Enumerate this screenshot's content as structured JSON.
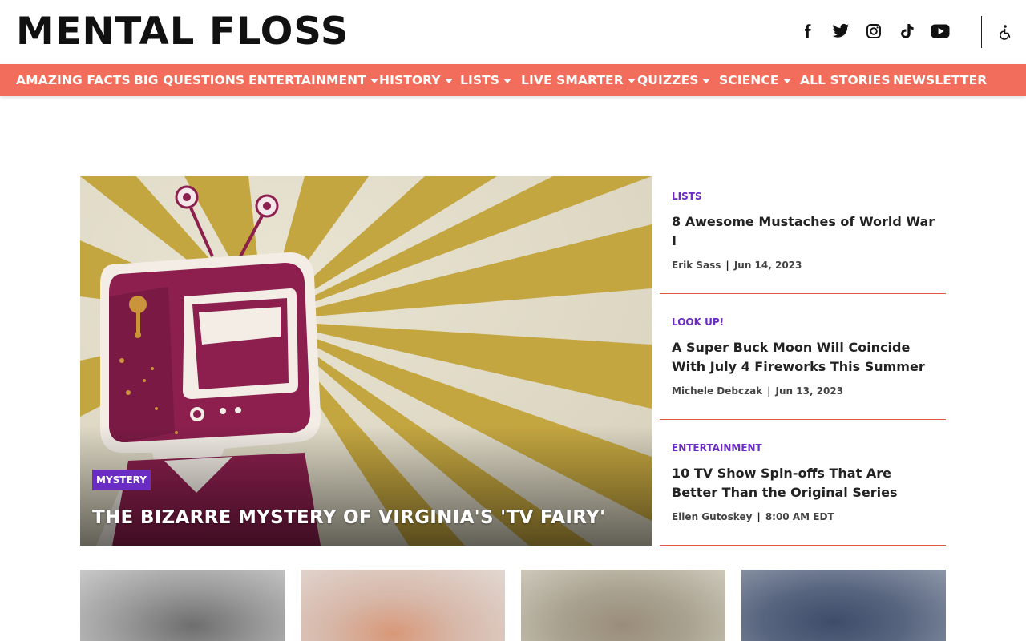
{
  "header": {
    "logo": "MENTAL FLOSS",
    "social": [
      {
        "icon": "facebook-icon"
      },
      {
        "icon": "twitter-icon"
      },
      {
        "icon": "instagram-icon"
      },
      {
        "icon": "tiktok-icon"
      },
      {
        "icon": "youtube-icon"
      }
    ],
    "accessibility_icon": "accessibility-icon"
  },
  "nav": {
    "items": [
      {
        "label": "AMAZING FACTS",
        "dropdown": false
      },
      {
        "label": "BIG QUESTIONS",
        "dropdown": false
      },
      {
        "label": "ENTERTAINMENT",
        "dropdown": true
      },
      {
        "label": "HISTORY",
        "dropdown": true
      },
      {
        "label": "LISTS",
        "dropdown": true
      },
      {
        "label": "LIVE SMARTER",
        "dropdown": true
      },
      {
        "label": "QUIZZES",
        "dropdown": true
      },
      {
        "label": "SCIENCE",
        "dropdown": true
      },
      {
        "label": "ALL STORIES",
        "dropdown": false
      },
      {
        "label": "NEWSLETTER",
        "dropdown": false
      }
    ]
  },
  "hero": {
    "category": "MYSTERY",
    "title": "THE BIZARRE MYSTERY OF VIRGINIA'S 'TV FAIRY'"
  },
  "stories": [
    {
      "category": "LISTS",
      "title": "8 Awesome Mustaches of World War I",
      "author": "Erik Sass",
      "date": "Jun 14, 2023"
    },
    {
      "category": "LOOK UP!",
      "title": "A Super Buck Moon Will Coincide With July 4 Fireworks This Summer",
      "author": "Michele Debczak",
      "date": "Jun 13, 2023"
    },
    {
      "category": "ENTERTAINMENT",
      "title": "10 TV Show Spin-offs That Are Better Than the Original Series",
      "author": "Ellen Gutoskey",
      "date": "8:00 AM EDT"
    }
  ],
  "colors": {
    "nav_bg": "#f26d5b",
    "category": "#6a2cc3",
    "divider": "#e0583f"
  }
}
